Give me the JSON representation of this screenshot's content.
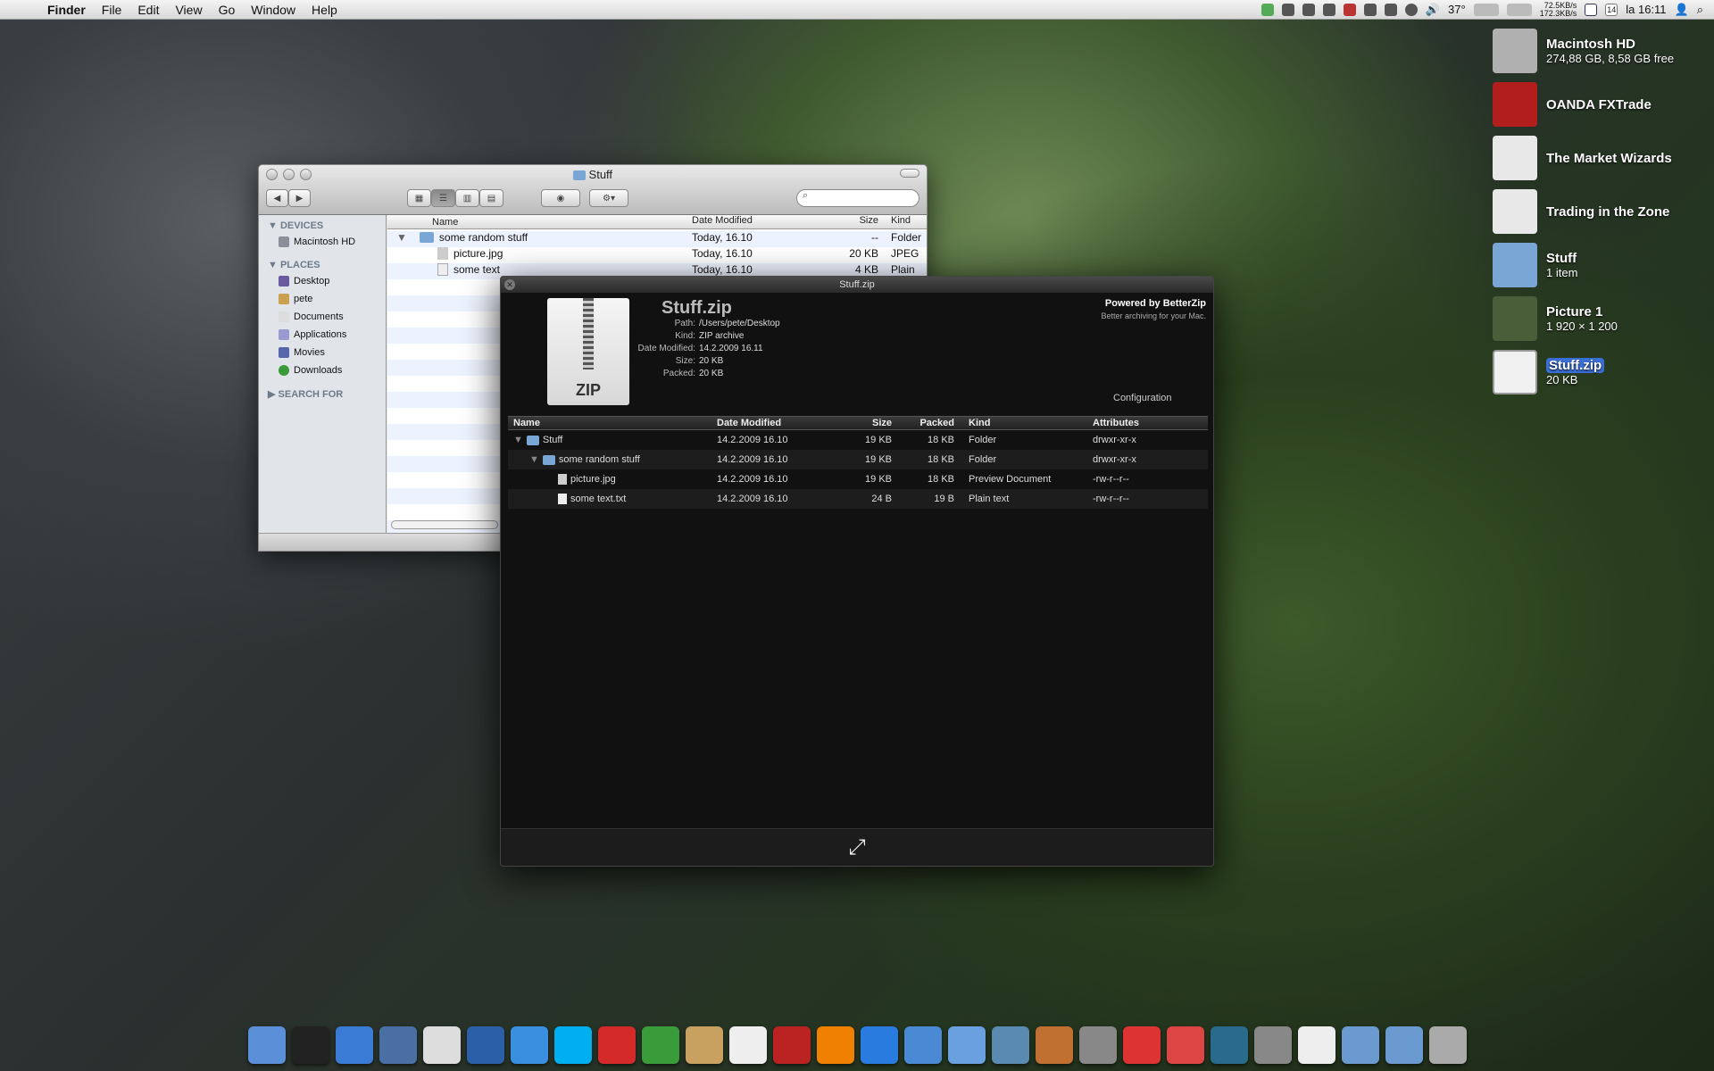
{
  "menubar": {
    "app": "Finder",
    "items": [
      "File",
      "Edit",
      "View",
      "Go",
      "Window",
      "Help"
    ],
    "temp": "37°",
    "net_up": "72.5KB/s",
    "net_down": "172.3KB/s",
    "clock": "la 16:11",
    "date_day": "14"
  },
  "desktop": [
    {
      "name": "Macintosh HD",
      "sub": "274,88 GB, 8,58 GB free",
      "icon": "hard-drive-icon",
      "color": "#b0b0b0"
    },
    {
      "name": "OANDA FXTrade",
      "sub": "",
      "icon": "fxtrade-app-icon",
      "color": "#b21e1e"
    },
    {
      "name": "The Market Wizards",
      "sub": "",
      "icon": "pdf-document-icon",
      "color": "#e8e8e8"
    },
    {
      "name": "Trading in the Zone",
      "sub": "",
      "icon": "pdf-document-icon",
      "color": "#e8e8e8"
    },
    {
      "name": "Stuff",
      "sub": "1 item",
      "icon": "folder-icon",
      "color": "#7aa6d6"
    },
    {
      "name": "Picture 1",
      "sub": "1 920 × 1 200",
      "icon": "picture-thumbnail-icon",
      "color": "#4a5e3a"
    },
    {
      "name": "Stuff.zip",
      "sub": "20 KB",
      "icon": "zip-file-icon",
      "color": "#f0f0f0"
    }
  ],
  "finder": {
    "title": "Stuff",
    "search_placeholder": "",
    "devices_label": "DEVICES",
    "devices": [
      "Macintosh HD"
    ],
    "places_label": "PLACES",
    "places": [
      "Desktop",
      "pete",
      "Documents",
      "Applications",
      "Movies",
      "Downloads"
    ],
    "search_for_label": "SEARCH FOR",
    "columns": [
      "Name",
      "Date Modified",
      "Size",
      "Kind"
    ],
    "rows": [
      {
        "name": "some random stuff",
        "date": "Today, 16.10",
        "size": "--",
        "kind": "Folder"
      },
      {
        "name": "picture.jpg",
        "date": "Today, 16.10",
        "size": "20 KB",
        "kind": "JPEG"
      },
      {
        "name": "some text",
        "date": "Today, 16.10",
        "size": "4 KB",
        "kind": "Plain"
      }
    ]
  },
  "betterzip": {
    "title": "Stuff.zip",
    "filename": "Stuff.zip",
    "zip_label": "ZIP",
    "path_label": "Path:",
    "path": "/Users/pete/Desktop",
    "kind_label": "Kind:",
    "kind": "ZIP archive",
    "date_label": "Date Modified:",
    "date": "14.2.2009 16.11",
    "size_label": "Size:",
    "size": "20 KB",
    "packed_label": "Packed:",
    "packed": "20 KB",
    "powered": "Powered by BetterZip",
    "tagline": "Better archiving for your Mac.",
    "config": "Configuration",
    "columns": [
      "Name",
      "Date Modified",
      "Size",
      "Packed",
      "Kind",
      "Attributes"
    ],
    "rows": [
      {
        "name": "Stuff",
        "date": "14.2.2009 16.10",
        "size": "19 KB",
        "packed": "18 KB",
        "kind": "Folder",
        "attr": "drwxr-xr-x"
      },
      {
        "name": "some random stuff",
        "date": "14.2.2009 16.10",
        "size": "19 KB",
        "packed": "18 KB",
        "kind": "Folder",
        "attr": "drwxr-xr-x"
      },
      {
        "name": "picture.jpg",
        "date": "14.2.2009 16.10",
        "size": "19 KB",
        "packed": "18 KB",
        "kind": "Preview Document",
        "attr": "-rw-r--r--"
      },
      {
        "name": "some text.txt",
        "date": "14.2.2009 16.10",
        "size": "24 B",
        "packed": "19 B",
        "kind": "Plain text",
        "attr": "-rw-r--r--"
      }
    ],
    "expand_glyph": "⤢"
  },
  "dock": [
    {
      "name": "finder",
      "color": "#5b8fd8"
    },
    {
      "name": "terminal",
      "color": "#222"
    },
    {
      "name": "safari",
      "color": "#3a7bd5"
    },
    {
      "name": "mail-bird",
      "color": "#4a6fa5"
    },
    {
      "name": "cot-editor",
      "color": "#ddd"
    },
    {
      "name": "google-earth",
      "color": "#2b5fa8"
    },
    {
      "name": "ichat",
      "color": "#3b8fe0"
    },
    {
      "name": "skype",
      "color": "#00aff0"
    },
    {
      "name": "magnet",
      "color": "#d42a2a"
    },
    {
      "name": "utorrent",
      "color": "#3a9b3a"
    },
    {
      "name": "transmit-truck",
      "color": "#c8a060"
    },
    {
      "name": "ical",
      "color": "#eee"
    },
    {
      "name": "photo-booth",
      "color": "#b22"
    },
    {
      "name": "vlc",
      "color": "#f08000"
    },
    {
      "name": "quicktime",
      "color": "#2a7be0"
    },
    {
      "name": "preview",
      "color": "#4a8ad4"
    },
    {
      "name": "itunes",
      "color": "#6aa0e0"
    },
    {
      "name": "iphoto",
      "color": "#5a8ab0"
    },
    {
      "name": "photo-app",
      "color": "#c07030"
    },
    {
      "name": "imovie-star",
      "color": "#888"
    },
    {
      "name": "parallels",
      "color": "#d33"
    },
    {
      "name": "paint-gun",
      "color": "#d44"
    },
    {
      "name": "time-machine",
      "color": "#2a6a8a"
    },
    {
      "name": "system-preferences",
      "color": "#888"
    },
    {
      "name": "textedit",
      "color": "#eee"
    },
    {
      "name": "applications-folder",
      "color": "#6a9ad0"
    },
    {
      "name": "documents-folder",
      "color": "#6a9ad0"
    },
    {
      "name": "trash",
      "color": "#aaa"
    }
  ]
}
